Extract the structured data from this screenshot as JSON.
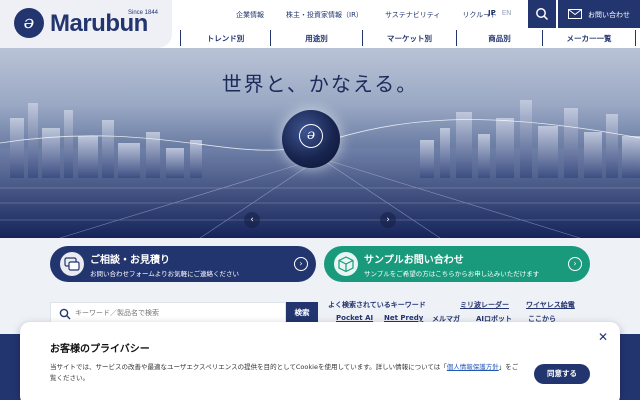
{
  "brand": {
    "name": "Marubun",
    "since": "Since 1844",
    "mark": "ə"
  },
  "header": {
    "util_nav": [
      "企業情報",
      "株主・投資家情報（IR）",
      "サステナビリティ",
      "リクルート"
    ],
    "lang_active": "JP",
    "lang_inactive": "EN",
    "contact_label": "お問い合わせ",
    "main_nav": [
      "トレンド別",
      "用途別",
      "マーケット別",
      "商品別",
      "メーカー一覧"
    ]
  },
  "hero": {
    "title": "世界と、かなえる。",
    "prev": "‹",
    "next": "›"
  },
  "banners": {
    "consult": {
      "title": "ご相談・お見積り",
      "sub": "お問い合わせフォームよりお気軽にご連絡ください",
      "arrow": "›"
    },
    "sample": {
      "title": "サンプルお問い合わせ",
      "sub": "サンプルをご希望の方はこちらからお申し込みいただけます",
      "arrow": "›"
    }
  },
  "search": {
    "placeholder": "キーワード／製品名で検索",
    "submit": "検索",
    "keywords_label": "よく検索されているキーワード",
    "keywords": [
      "ミリ波レーダー",
      "ワイヤレス給電",
      "Pocket AI",
      "Net Predy",
      "メルマガ",
      "AIロボット",
      "ここから"
    ]
  },
  "privacy": {
    "title": "お客様のプライバシー",
    "text_before": "当サイトでは、サービスの改善や最適なユーザエクスペリエンスの提供を目的としてCookieを使用しています。詳しい情報については「",
    "link": "個人情報保護方針",
    "text_after": "」をご覧ください。",
    "agree": "同意する",
    "close": "✕"
  },
  "colors": {
    "navy": "#23356f",
    "green": "#1a9a7c",
    "link": "#2357b5"
  }
}
